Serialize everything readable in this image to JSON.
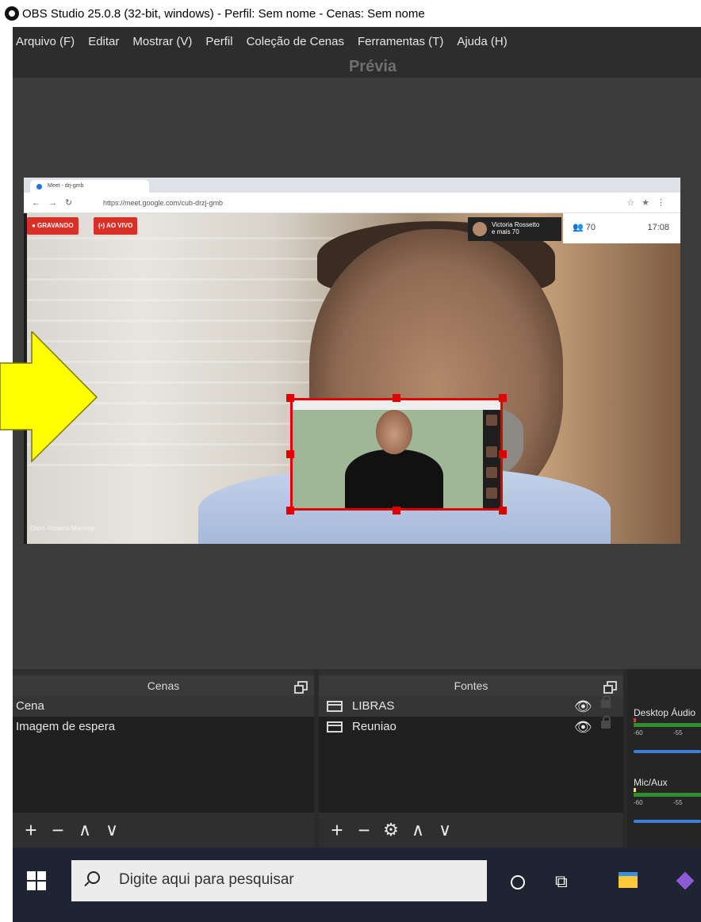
{
  "window": {
    "title": "OBS Studio 25.0.8 (32-bit, windows) - Perfil: Sem nome - Cenas: Sem nome"
  },
  "menu": [
    "Arquivo (F)",
    "Editar",
    "Mostrar (V)",
    "Perfil",
    "Coleção de Cenas",
    "Ferramentas (T)",
    "Ajuda (H)"
  ],
  "preview": {
    "label": "Prévia",
    "browser": {
      "tab_title": "Meet - drj-gmb",
      "url": "https://meet.google.com/cub-drzj-gmb",
      "recording_label": "● GRAVANDO",
      "live_label": "(•) AO VIVO",
      "participant_name": "Victoria Rossetto",
      "participant_more": "e mais 70",
      "people_count": "70",
      "time": "17:08",
      "presenter_name": "Dario Roberto Martens"
    }
  },
  "scenes": {
    "header": "Cenas",
    "items": [
      {
        "label": "Cena",
        "selected": true
      },
      {
        "label": "Imagem de espera",
        "selected": false
      }
    ],
    "toolbar": [
      "+",
      "−",
      "∧",
      "∨"
    ]
  },
  "sources": {
    "header": "Fontes",
    "items": [
      {
        "label": "LIBRAS",
        "visible": true,
        "locked": false
      },
      {
        "label": "Reuniao",
        "visible": true,
        "locked": false
      }
    ],
    "toolbar": [
      "+",
      "−",
      "⚙",
      "∧",
      "∨"
    ]
  },
  "mixer": {
    "channels": [
      {
        "name": "Desktop Áudio",
        "tick_left": "-60",
        "tick_right": "-55"
      },
      {
        "name": "Mic/Aux",
        "tick_left": "-60",
        "tick_right": "-55"
      }
    ]
  },
  "taskbar": {
    "search_placeholder": "Digite aqui para pesquisar"
  },
  "colors": {
    "selection": "#e00000",
    "arrow": "#ffff00",
    "obs_bg": "#3a3a3a",
    "taskbar": "#1f2432"
  },
  "icons": [
    "obs-logo-icon",
    "float-dock-icon",
    "eye-icon",
    "lock-icon",
    "gear-icon",
    "windows-start-icon",
    "search-icon",
    "cortana-icon",
    "task-view-icon",
    "file-explorer-icon",
    "visual-studio-icon"
  ]
}
